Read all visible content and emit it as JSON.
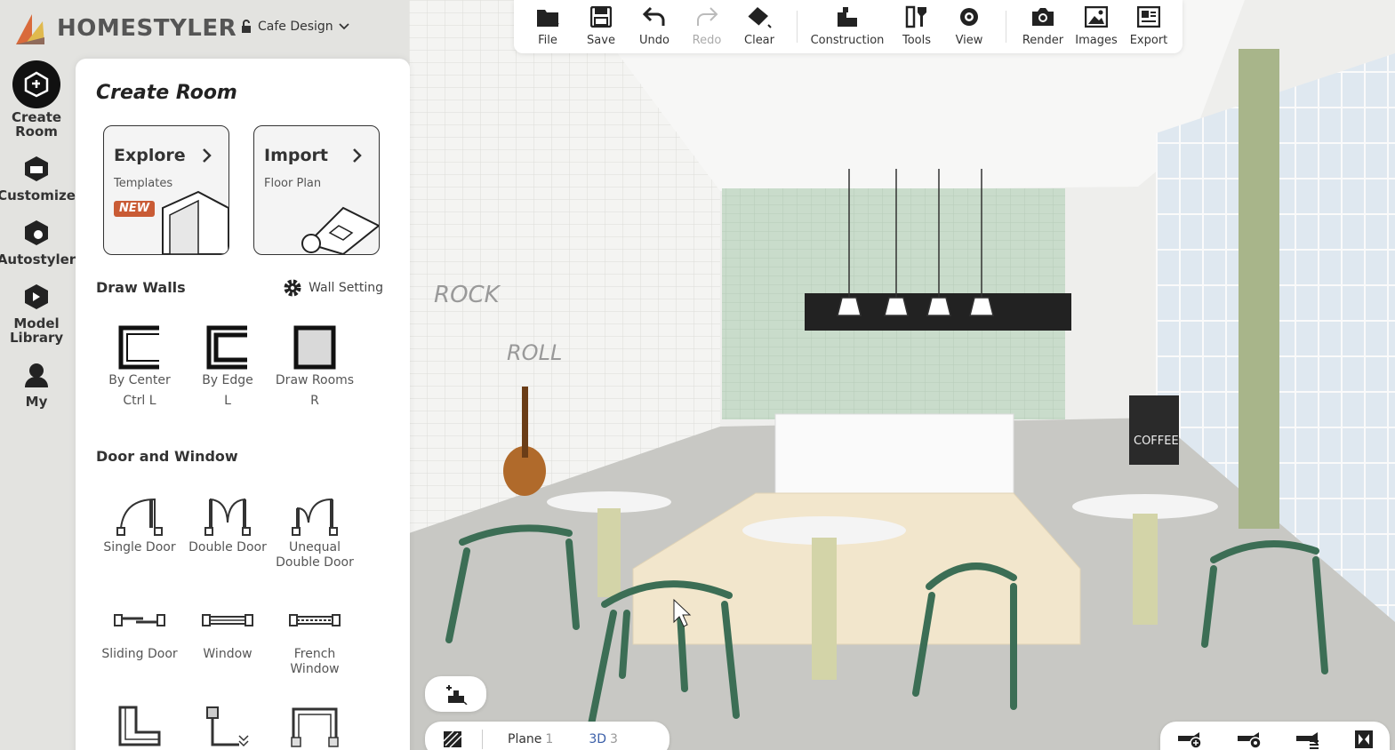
{
  "app": {
    "brand": "HOMESTYLER",
    "project_name": "Cafe Design"
  },
  "rail": [
    {
      "label": "Create Room",
      "icon": "create-room-icon"
    },
    {
      "label": "Customize",
      "icon": "customize-icon"
    },
    {
      "label": "Autostyler",
      "icon": "autostyler-icon"
    },
    {
      "label": "Model Library",
      "icon": "model-library-icon"
    },
    {
      "label": "My",
      "icon": "my-icon"
    }
  ],
  "panel": {
    "title": "Create Room",
    "cards": [
      {
        "title": "Explore",
        "subtitle": "Templates",
        "badge": "NEW"
      },
      {
        "title": "Import",
        "subtitle": "Floor Plan"
      }
    ],
    "draw_walls": {
      "title": "Draw Walls",
      "setting": "Wall Setting",
      "tools": [
        {
          "label": "By Center",
          "key": "Ctrl L"
        },
        {
          "label": "By Edge",
          "key": "L"
        },
        {
          "label": "Draw Rooms",
          "key": "R"
        }
      ]
    },
    "door_window": {
      "title": "Door and Window",
      "tools": [
        {
          "label": "Single Door"
        },
        {
          "label": "Double Door"
        },
        {
          "label": "Unequal Double Door"
        },
        {
          "label": "Sliding Door"
        },
        {
          "label": "Window"
        },
        {
          "label": "French Window"
        }
      ]
    }
  },
  "toolbar": [
    {
      "label": "File",
      "icon": "folder-icon"
    },
    {
      "label": "Save",
      "icon": "save-icon"
    },
    {
      "label": "Undo",
      "icon": "undo-icon"
    },
    {
      "label": "Redo",
      "icon": "redo-icon",
      "disabled": true
    },
    {
      "label": "Clear",
      "icon": "eraser-icon"
    },
    {
      "label": "Construction",
      "icon": "construction-icon"
    },
    {
      "label": "Tools",
      "icon": "tools-icon"
    },
    {
      "label": "View",
      "icon": "eye-icon"
    },
    {
      "label": "Render",
      "icon": "camera-icon"
    },
    {
      "label": "Images",
      "icon": "image-icon"
    },
    {
      "label": "Export",
      "icon": "export-icon"
    }
  ],
  "bottom": {
    "views": [
      {
        "label": "Plane",
        "num": "1"
      },
      {
        "label": "3D",
        "num": "3"
      }
    ]
  },
  "scene": {
    "wall_text_1": "ROCK",
    "wall_text_2": "ROLL",
    "sign": "COFFEE"
  },
  "colors": {
    "accent": "#c95b35",
    "chair_green": "#3c6e55",
    "tile_green": "#c9dccb"
  }
}
